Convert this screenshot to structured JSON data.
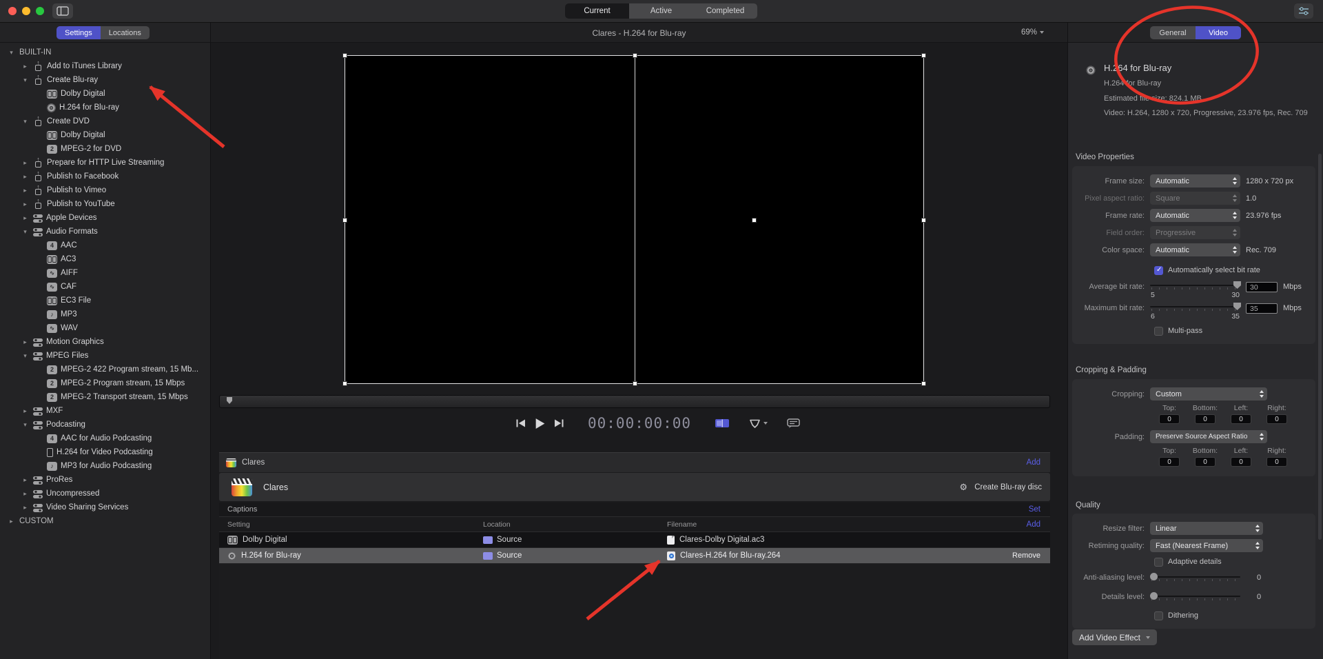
{
  "titlebar": {
    "tabs": [
      "Current",
      "Active",
      "Completed"
    ],
    "active_tab": "Current"
  },
  "sidebar": {
    "tabs": [
      "Settings",
      "Locations"
    ],
    "active_tab": "Settings",
    "tree": [
      {
        "i": 0,
        "a": "v",
        "ic": "",
        "t": "BUILT-IN"
      },
      {
        "i": 1,
        "a": "r",
        "ic": "share",
        "t": "Add to iTunes Library"
      },
      {
        "i": 1,
        "a": "v",
        "ic": "share",
        "t": "Create Blu-ray"
      },
      {
        "i": 2,
        "a": "",
        "ic": "ac3",
        "t": "Dolby Digital"
      },
      {
        "i": 2,
        "a": "",
        "ic": "disc",
        "t": "H.264 for Blu-ray"
      },
      {
        "i": 1,
        "a": "v",
        "ic": "share",
        "t": "Create DVD"
      },
      {
        "i": 2,
        "a": "",
        "ic": "ac3",
        "t": "Dolby Digital"
      },
      {
        "i": 2,
        "a": "",
        "ic": "num2",
        "t": "MPEG-2 for DVD"
      },
      {
        "i": 1,
        "a": "r",
        "ic": "share",
        "t": "Prepare for HTTP Live Streaming"
      },
      {
        "i": 1,
        "a": "r",
        "ic": "share",
        "t": "Publish to Facebook"
      },
      {
        "i": 1,
        "a": "r",
        "ic": "share",
        "t": "Publish to Vimeo"
      },
      {
        "i": 1,
        "a": "r",
        "ic": "share",
        "t": "Publish to YouTube"
      },
      {
        "i": 1,
        "a": "r",
        "ic": "group",
        "t": "Apple Devices"
      },
      {
        "i": 1,
        "a": "v",
        "ic": "group",
        "t": "Audio Formats"
      },
      {
        "i": 2,
        "a": "",
        "ic": "num4",
        "t": "AAC"
      },
      {
        "i": 2,
        "a": "",
        "ic": "ac3",
        "t": "AC3"
      },
      {
        "i": 2,
        "a": "",
        "ic": "wave",
        "t": "AIFF"
      },
      {
        "i": 2,
        "a": "",
        "ic": "wave",
        "t": "CAF"
      },
      {
        "i": 2,
        "a": "",
        "ic": "ac3",
        "t": "EC3 File"
      },
      {
        "i": 2,
        "a": "",
        "ic": "mp3",
        "t": "MP3"
      },
      {
        "i": 2,
        "a": "",
        "ic": "wave",
        "t": "WAV"
      },
      {
        "i": 1,
        "a": "r",
        "ic": "group",
        "t": "Motion Graphics"
      },
      {
        "i": 1,
        "a": "v",
        "ic": "group",
        "t": "MPEG Files"
      },
      {
        "i": 2,
        "a": "",
        "ic": "num2",
        "t": "MPEG-2 422 Program stream, 15 Mb..."
      },
      {
        "i": 2,
        "a": "",
        "ic": "num2",
        "t": "MPEG-2 Program stream, 15 Mbps"
      },
      {
        "i": 2,
        "a": "",
        "ic": "num2",
        "t": "MPEG-2 Transport stream, 15 Mbps"
      },
      {
        "i": 1,
        "a": "r",
        "ic": "group",
        "t": "MXF"
      },
      {
        "i": 1,
        "a": "v",
        "ic": "group",
        "t": "Podcasting"
      },
      {
        "i": 2,
        "a": "",
        "ic": "num4",
        "t": "AAC for Audio Podcasting"
      },
      {
        "i": 2,
        "a": "",
        "ic": "phone",
        "t": "H.264 for Video Podcasting"
      },
      {
        "i": 2,
        "a": "",
        "ic": "mp3",
        "t": "MP3 for Audio Podcasting"
      },
      {
        "i": 1,
        "a": "r",
        "ic": "group",
        "t": "ProRes"
      },
      {
        "i": 1,
        "a": "r",
        "ic": "group",
        "t": "Uncompressed"
      },
      {
        "i": 1,
        "a": "r",
        "ic": "group",
        "t": "Video Sharing Services"
      },
      {
        "i": 0,
        "a": "r",
        "ic": "",
        "t": "CUSTOM"
      }
    ]
  },
  "preview": {
    "title": "Clares - H.264 for Blu-ray",
    "zoom": "69%",
    "timecode": "00:00:00:00"
  },
  "batch": {
    "header_title": "Clares",
    "add_label": "Add",
    "job_title": "Clares",
    "job_action": "Create Blu-ray disc",
    "captions_label": "Captions",
    "set_label": "Set",
    "columns": [
      "Setting",
      "Location",
      "Filename"
    ],
    "rows": [
      {
        "icon": "ac3",
        "setting": "Dolby Digital",
        "location": "Source",
        "file_icon": "doc",
        "filename": "Clares-Dolby Digital.ac3",
        "selected": false,
        "remove": ""
      },
      {
        "icon": "disc",
        "setting": "H.264 for Blu-ray",
        "location": "Source",
        "file_icon": "file264",
        "filename": "Clares-H.264 for Blu-ray.264",
        "selected": true,
        "remove": "Remove"
      }
    ]
  },
  "inspector": {
    "tabs": [
      "General",
      "Video"
    ],
    "active_tab": "Video",
    "header": {
      "title": "H.264 for Blu-ray",
      "subtitle": "H.264 for Blu-ray",
      "filesize": "Estimated file size: 824.1 MB",
      "info": "Video: H.264, 1280 x 720, Progressive, 23.976 fps, Rec. 709"
    },
    "video_properties": {
      "title": "Video Properties",
      "rows": [
        {
          "label": "Frame size:",
          "value": "Automatic",
          "suffix": "1280 x 720 px",
          "disabled": false
        },
        {
          "label": "Pixel aspect ratio:",
          "value": "Square",
          "suffix": "1.0",
          "disabled": true
        },
        {
          "label": "Frame rate:",
          "value": "Automatic",
          "suffix": "23.976 fps",
          "disabled": false
        },
        {
          "label": "Field order:",
          "value": "Progressive",
          "suffix": "",
          "disabled": true
        },
        {
          "label": "Color space:",
          "value": "Automatic",
          "suffix": "Rec. 709",
          "disabled": false
        }
      ],
      "auto_bitrate": {
        "label": "Automatically select bit rate",
        "checked": true
      },
      "sliders": [
        {
          "label": "Average bit rate:",
          "min": "5",
          "max": "30",
          "value": "30",
          "unit": "Mbps"
        },
        {
          "label": "Maximum bit rate:",
          "min": "6",
          "max": "35",
          "value": "35",
          "unit": "Mbps"
        }
      ],
      "multipass": {
        "label": "Multi-pass",
        "checked": false
      }
    },
    "cropping": {
      "title": "Cropping & Padding",
      "cropping_label": "Cropping:",
      "cropping_value": "Custom",
      "crop_fields": [
        {
          "label": "Top:",
          "value": "0"
        },
        {
          "label": "Bottom:",
          "value": "0"
        },
        {
          "label": "Left:",
          "value": "0"
        },
        {
          "label": "Right:",
          "value": "0"
        }
      ],
      "padding_label": "Padding:",
      "padding_value": "Preserve Source Aspect Ratio",
      "pad_fields": [
        {
          "label": "Top:",
          "value": "0"
        },
        {
          "label": "Bottom:",
          "value": "0"
        },
        {
          "label": "Left:",
          "value": "0"
        },
        {
          "label": "Right:",
          "value": "0"
        }
      ]
    },
    "quality": {
      "title": "Quality",
      "rows": [
        {
          "label": "Resize filter:",
          "value": "Linear"
        },
        {
          "label": "Retiming quality:",
          "value": "Fast (Nearest Frame)"
        }
      ],
      "adaptive": {
        "label": "Adaptive details",
        "checked": false
      },
      "sliders": [
        {
          "label": "Anti-aliasing level:",
          "value": "0"
        },
        {
          "label": "Details level:",
          "value": "0"
        }
      ],
      "dithering": {
        "label": "Dithering",
        "checked": false
      },
      "add_effect": "Add Video Effect"
    }
  },
  "annotations": {
    "color": "#e5342a"
  },
  "colors": {
    "accent": "#4f52c7",
    "link": "#5a5ee8",
    "selected_row": "#58585a"
  }
}
